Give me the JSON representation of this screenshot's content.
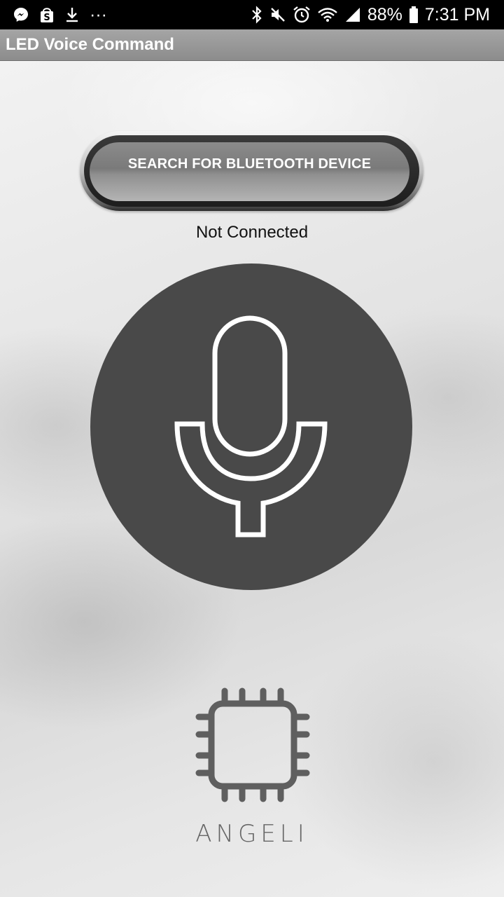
{
  "status_bar": {
    "more_glyph": "···",
    "battery_percent": "88%",
    "time": "7:31 PM",
    "icons_left": [
      "messenger-icon",
      "shop-icon",
      "download-icon",
      "more-icon"
    ],
    "icons_right": [
      "bluetooth-icon",
      "mute-icon",
      "alarm-icon",
      "wifi-icon",
      "signal-icon",
      "battery-icon"
    ]
  },
  "app": {
    "title": "LED Voice Command"
  },
  "search_button": {
    "label": "SEARCH FOR BLUETOOTH DEVICE"
  },
  "connection": {
    "status": "Not Connected"
  },
  "mic_button": {
    "icon": "microphone-icon",
    "color": "#494949"
  },
  "brand": {
    "name": "ANGELI",
    "icon": "chip-icon"
  }
}
